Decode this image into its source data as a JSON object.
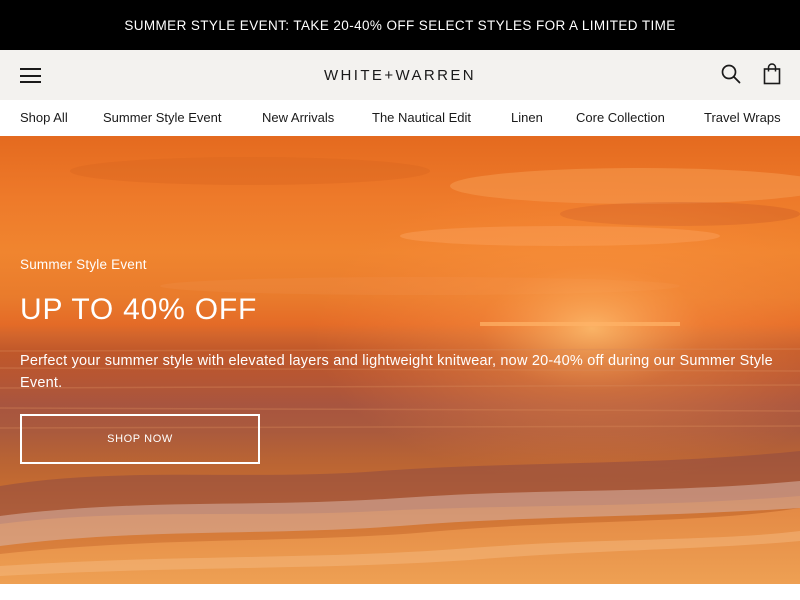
{
  "promo": {
    "text": "SUMMER STYLE EVENT: TAKE 20-40% OFF SELECT STYLES FOR A LIMITED TIME"
  },
  "header": {
    "logo": "WHITE+WARREN",
    "menu_icon": "menu-icon",
    "search_icon": "search-icon",
    "bag_icon": "shopping-bag-icon"
  },
  "nav": {
    "items": [
      {
        "label": "Shop All"
      },
      {
        "label": "Summer Style Event"
      },
      {
        "label": "New Arrivals"
      },
      {
        "label": "The Nautical Edit"
      },
      {
        "label": "Linen"
      },
      {
        "label": "Core Collection"
      },
      {
        "label": "Travel Wraps"
      }
    ]
  },
  "hero": {
    "eyebrow": "Summer Style Event",
    "title": "UP TO 40% OFF",
    "description": "Perfect your summer style with elevated layers and lightweight knitwear, now 20-40% off during our Summer Style Event.",
    "cta": "SHOP NOW"
  },
  "colors": {
    "promo_bg": "#000000",
    "header_bg": "#f3f2ef",
    "text_dark": "#1a1a1a",
    "hero_text": "#ffffff"
  }
}
